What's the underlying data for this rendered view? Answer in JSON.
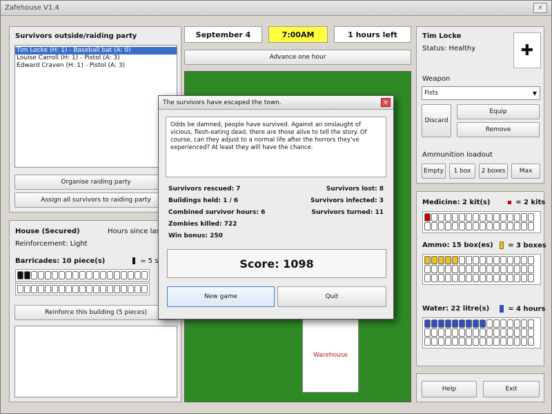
{
  "window": {
    "title": "Zafehouse V1.4"
  },
  "survivors_panel": {
    "heading": "Survivors outside/raiding party",
    "items": [
      "Tim Locke (H: 1) - Baseball bat (A: 0)",
      "Louise Carroll (H: 1) - Pistol (A: 3)",
      "Edward Craven (H: 1) - Pistol (A: 3)"
    ],
    "organise_button": "Organise raiding party",
    "assign_button": "Assign all survivors to raiding party"
  },
  "house_panel": {
    "title": "House (Secured)",
    "hours_since": "Hours since last att",
    "reinforcement": "Reinforcement: Light",
    "barricades": "Barricades: 10 piece(s)",
    "barricade_key": "= 5 su",
    "reinforce_button": "Reinforce this building (5 pieces)"
  },
  "top_bar": {
    "date": "September 4",
    "time": "7:00AM",
    "time_left": "1 hours left",
    "advance_button": "Advance one hour"
  },
  "map": {
    "building_label": "Warehouse"
  },
  "character": {
    "name": "Tim Locke",
    "status": "Status: Healthy",
    "weapon_label": "Weapon",
    "weapon_selected": "Fists",
    "discard_button": "Discard",
    "equip_button": "Equip",
    "remove_button": "Remove",
    "ammo_label": "Ammunition loadout",
    "ammo_buttons": [
      "Empty",
      "1 box",
      "2 boxes",
      "Max"
    ]
  },
  "supplies": {
    "medicine": {
      "label": "Medicine: 2 kit(s)",
      "key": "= 2 kits",
      "filled": 1,
      "color": "#cc0000"
    },
    "ammo": {
      "label": "Ammo: 15 box(es)",
      "key": "= 3 boxes",
      "filled": 5,
      "color": "#e8c020"
    },
    "water": {
      "label": "Water: 22 litre(s)",
      "key": "= 4 hours",
      "filled": 9,
      "color": "#3050c0"
    }
  },
  "bottom_buttons": {
    "help": "Help",
    "exit": "Exit"
  },
  "dialog": {
    "title": "The survivors have escaped the town.",
    "message": "Odds be damned, people have survived. Against an onslaught of vicious, flesh-eating dead, there are those alive to tell the story. Of course, can they adjust to a normal life after the horrors they've experienced? At least they will have the chance.",
    "stats_left": [
      "Survivors rescued: 7",
      "Buildings held: 1 / 6",
      "Combined survivor hours: 6",
      "Zombies killed: 722",
      "Win bonus: 250"
    ],
    "stats_right": [
      "Survivors lost: 8",
      "Survivors infected: 3",
      "Survivors turned: 11"
    ],
    "score": "Score: 1098",
    "new_game_button": "New game",
    "quit_button": "Quit"
  }
}
